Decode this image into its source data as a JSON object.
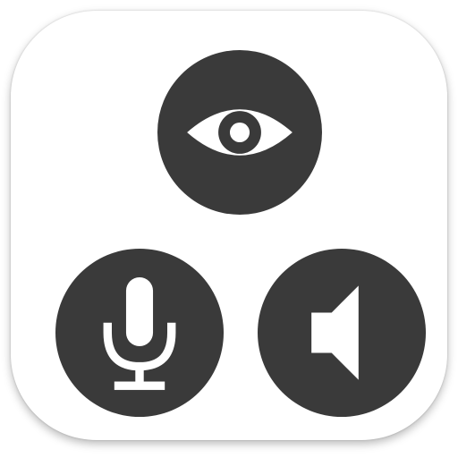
{
  "app_icon": {
    "name": "",
    "colors": {
      "tile_background": "#ffffff",
      "disc_fill": "#3a3a3a",
      "glyph": "#ffffff"
    },
    "symbols": [
      {
        "id": "eye",
        "icon": "eye-icon"
      },
      {
        "id": "microphone",
        "icon": "microphone-icon"
      },
      {
        "id": "speaker",
        "icon": "speaker-icon"
      }
    ]
  }
}
